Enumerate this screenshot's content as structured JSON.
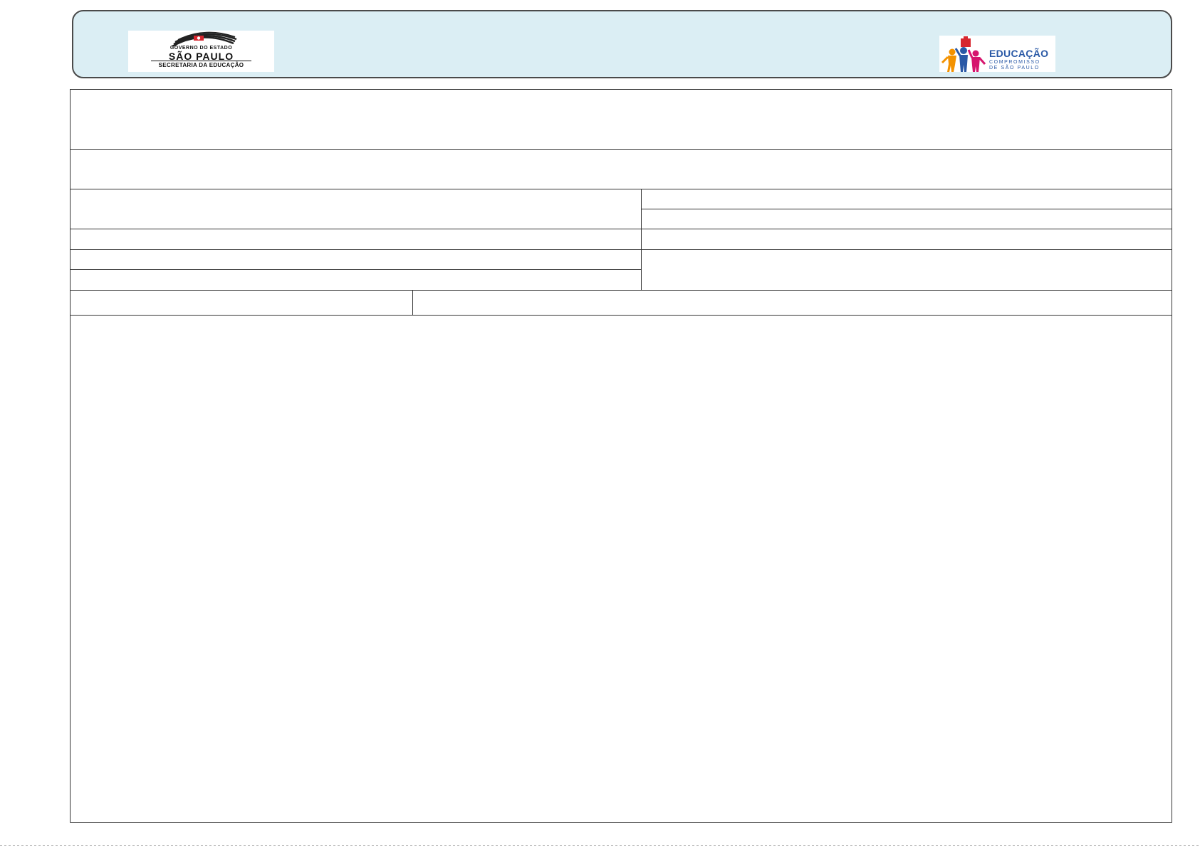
{
  "header": {
    "left_logo": {
      "line1": "GOVERNO DO ESTADO",
      "line2": "SÃO PAULO",
      "line3": "SECRETARIA DA EDUCAÇÃO"
    },
    "right_logo": {
      "line1": "EDUCAÇÃO",
      "line2": "COMPROMISSO",
      "line3": "DE SÃO PAULO"
    },
    "colors": {
      "band_background": "#dbeef4",
      "band_border": "#4a4a4a",
      "edu_text": "#2a59a6",
      "figure_orange": "#f39200",
      "figure_blue": "#2a59a6",
      "figure_magenta": "#d6156e",
      "flag_red": "#d7262e"
    },
    "icons": [
      "sao-paulo-flag-logo",
      "education-people-logo"
    ]
  },
  "form": {
    "title_row": "",
    "subtitle_row": "",
    "row3_left": "",
    "row3_right_top": "",
    "row3_right_bottom": "",
    "row4_left": "",
    "row4_right": "",
    "row5_left_top": "",
    "row5_left_bottom": "",
    "row5_right": "",
    "row6_left": "",
    "row6_right": "",
    "body": ""
  }
}
